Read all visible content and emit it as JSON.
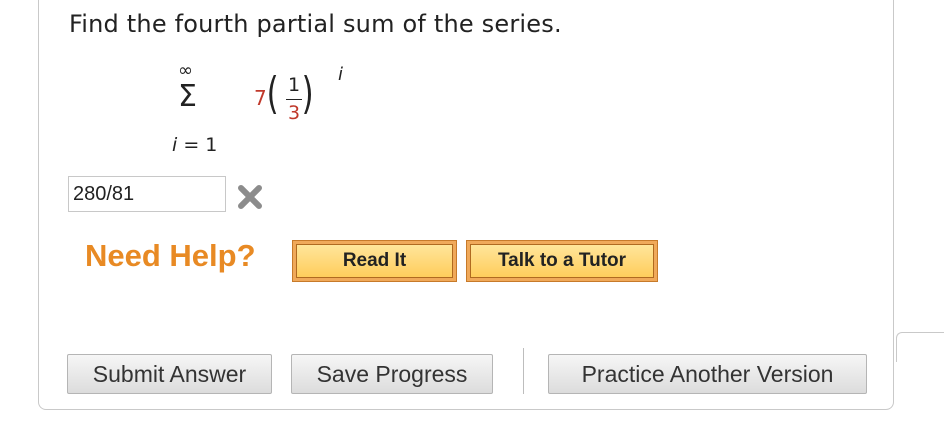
{
  "question": {
    "text": "Find the fourth partial sum of the series."
  },
  "math": {
    "sigma": "Σ",
    "upper_limit": "∞",
    "lower_index": "i",
    "lower_eq": " = 1",
    "coefficient": "7",
    "numerator": "1",
    "denominator": "3",
    "exponent": "i",
    "coef_color": "#c0392b"
  },
  "answer": {
    "value": "280/81",
    "status_icon": "wrong-x-icon"
  },
  "help": {
    "label": "Need Help?",
    "read_it": "Read It",
    "tutor": "Talk to a Tutor"
  },
  "actions": {
    "submit": "Submit Answer",
    "save": "Save Progress",
    "practice": "Practice Another Version"
  }
}
